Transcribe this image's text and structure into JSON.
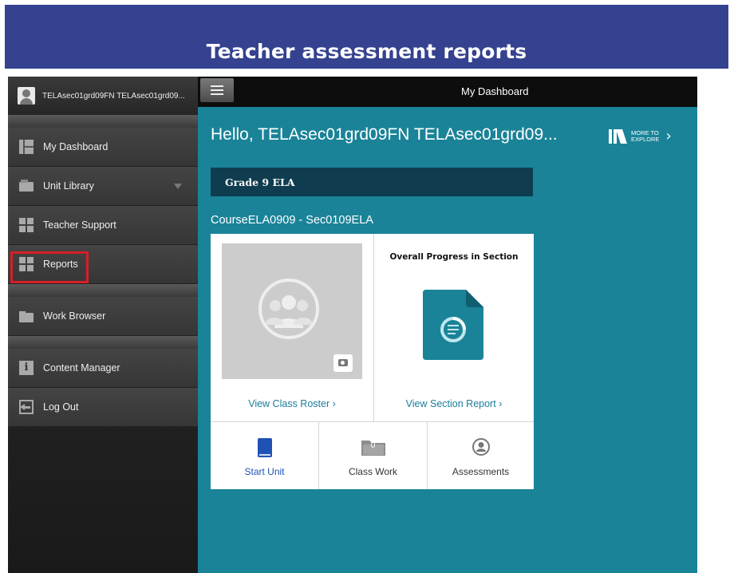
{
  "banner": {
    "title": "Teacher assessment reports"
  },
  "sidebar": {
    "user_name": "TELAsec01grd09FN TELAsec01grd09...",
    "items": [
      {
        "label": "My Dashboard",
        "icon": "dashboard-icon"
      },
      {
        "label": "Unit Library",
        "icon": "unit-library-icon"
      },
      {
        "label": "Teacher Support",
        "icon": "teacher-support-icon"
      },
      {
        "label": "Reports",
        "icon": "reports-icon"
      },
      {
        "label": "Work Browser",
        "icon": "folder-icon"
      },
      {
        "label": "Content Manager",
        "icon": "info-icon"
      },
      {
        "label": "Log Out",
        "icon": "logout-icon"
      }
    ],
    "highlight_color": "#d61f26"
  },
  "topbar": {
    "title": "My Dashboard"
  },
  "main": {
    "greeting": "Hello, TELAsec01grd09FN TELAsec01grd09...",
    "explore_line1": "MORE TO",
    "explore_line2": "EXPLORE",
    "grade_label": "Grade 9 ELA",
    "course_title": "CourseELA0909 - Sec0109ELA",
    "overall_title": "Overall Progress in Section",
    "view_roster": "View Class Roster",
    "view_section_report": "View Section Report",
    "chevron": "›",
    "actions": [
      {
        "label": "Start Unit",
        "icon": "book-icon"
      },
      {
        "label": "Class Work",
        "icon": "folder-icon",
        "badge": "0"
      },
      {
        "label": "Assessments",
        "icon": "assessment-user-icon"
      }
    ],
    "colors": {
      "background": "#1a8398",
      "grade_bar": "#0f3d4f",
      "link": "#1a7d9a",
      "start_unit": "#2052b5"
    }
  }
}
